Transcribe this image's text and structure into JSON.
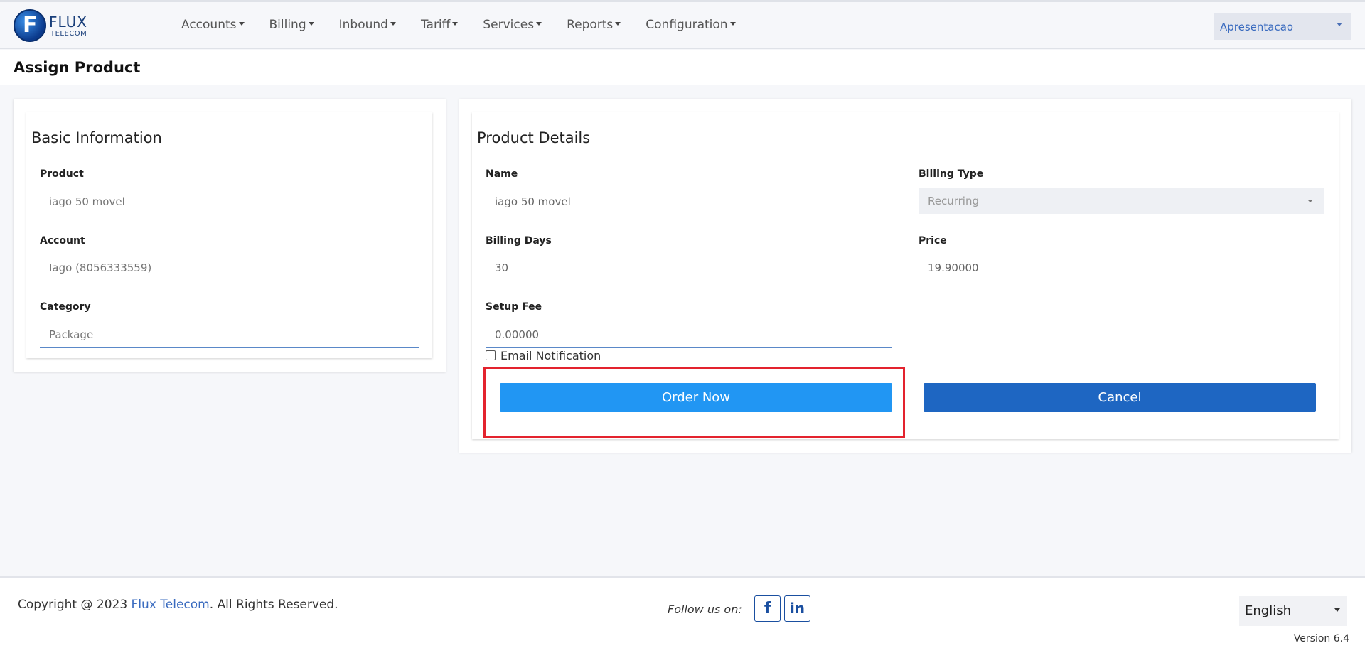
{
  "brand": {
    "logo_letter": "F",
    "name": "FLUX",
    "sub": "TELECOM"
  },
  "nav": {
    "items": [
      {
        "label": "Accounts"
      },
      {
        "label": "Billing"
      },
      {
        "label": "Inbound"
      },
      {
        "label": "Tariff"
      },
      {
        "label": "Services"
      },
      {
        "label": "Reports"
      },
      {
        "label": "Configuration"
      }
    ],
    "user": "Apresentacao"
  },
  "page": {
    "title": "Assign Product"
  },
  "basic_info": {
    "title": "Basic Information",
    "product_label": "Product",
    "product_placeholder": "iago 50 movel",
    "account_label": "Account",
    "account_placeholder": "Iago (8056333559)",
    "category_label": "Category",
    "category_placeholder": "Package"
  },
  "product_details": {
    "title": "Product Details",
    "name_label": "Name",
    "name_value": "iago 50 movel",
    "billing_type_label": "Billing Type",
    "billing_type_value": "Recurring",
    "billing_days_label": "Billing Days",
    "billing_days_value": "30",
    "price_label": "Price",
    "price_value": "19.90000",
    "setup_fee_label": "Setup Fee",
    "setup_fee_value": "0.00000",
    "email_notification_label": "Email Notification",
    "order_now_label": "Order Now",
    "cancel_label": "Cancel"
  },
  "footer": {
    "copyright_prefix": "Copyright @ 2023 ",
    "company": "Flux Telecom",
    "copyright_suffix": ". All Rights Reserved.",
    "follow_label": "Follow us on:",
    "facebook_glyph": "f",
    "linkedin_glyph": "in",
    "language": "English",
    "version": "Version 6.4"
  },
  "colors": {
    "order_button": "#2196f3",
    "cancel_button": "#1e66c2",
    "highlight": "#e3232e"
  }
}
